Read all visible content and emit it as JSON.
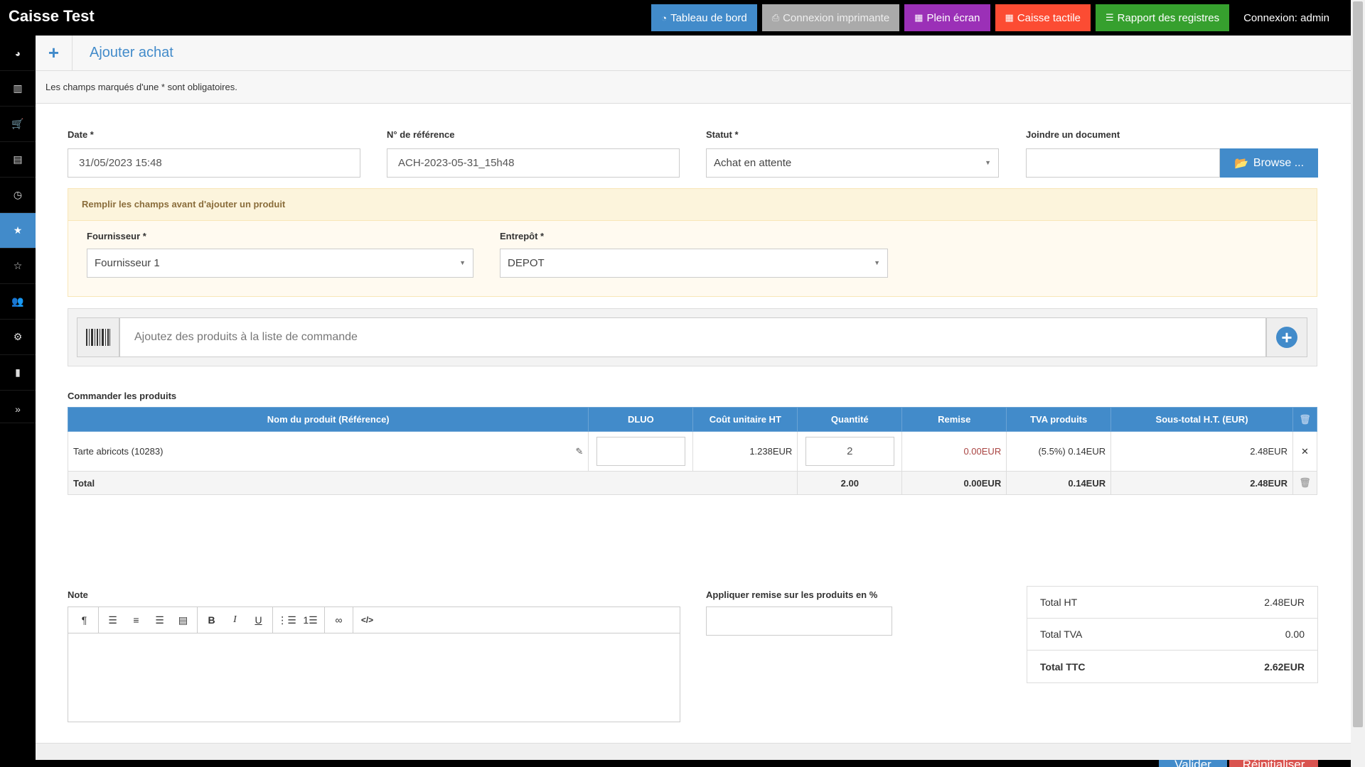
{
  "app": {
    "title": "Caisse Test"
  },
  "topnav": {
    "dashboard": "Tableau de bord",
    "printer": "Connexion imprimante",
    "fullscreen": "Plein écran",
    "touch": "Caisse tactile",
    "register": "Rapport des registres",
    "login": "Connexion: admin"
  },
  "sidebar": {
    "items": [
      "dashboard-icon",
      "barcode-icon",
      "cart-icon",
      "document-icon",
      "clock-icon",
      "star-icon",
      "star-outline-icon",
      "users-icon",
      "gear-icon",
      "chart-icon",
      "expand-icon"
    ],
    "active_index": 5
  },
  "page": {
    "title": "Ajouter achat",
    "required_note": "Les champs marqués d'une * sont obligatoires."
  },
  "form": {
    "date_label": "Date *",
    "date_value": "31/05/2023 15:48",
    "ref_label": "N° de référence",
    "ref_value": "ACH-2023-05-31_15h48",
    "status_label": "Statut *",
    "status_value": "Achat en attente",
    "attach_label": "Joindre un document",
    "browse_label": "Browse ...",
    "notice": "Remplir les champs avant d'ajouter un produit",
    "supplier_label": "Fournisseur *",
    "supplier_value": "Fournisseur 1",
    "warehouse_label": "Entrepôt *",
    "warehouse_value": "DEPOT",
    "add_placeholder": "Ajoutez des produits à la liste de commande"
  },
  "order": {
    "section_label": "Commander les produits",
    "headers": [
      "Nom du produit (Référence)",
      "DLUO",
      "Coût unitaire HT",
      "Quantité",
      "Remise",
      "TVA produits",
      "Sous-total H.T. (EUR)"
    ],
    "rows": [
      {
        "name": "Tarte abricots (10283)",
        "dluo": "",
        "unit_cost": "1.238EUR",
        "qty": "2",
        "discount": "0.00EUR",
        "tax": "(5.5%) 0.14EUR",
        "subtotal": "2.48EUR"
      }
    ],
    "total": {
      "label": "Total",
      "qty": "2.00",
      "discount": "0.00EUR",
      "tax": "0.14EUR",
      "subtotal": "2.48EUR"
    }
  },
  "note": {
    "label": "Note"
  },
  "discount": {
    "label": "Appliquer remise sur les produits en %",
    "value": ""
  },
  "totals": {
    "ht_label": "Total HT",
    "ht_value": "2.48EUR",
    "tva_label": "Total TVA",
    "tva_value": "0.00",
    "ttc_label": "Total TTC",
    "ttc_value": "2.62EUR"
  },
  "actions": {
    "submit": "Valider",
    "reset": "Réinitialiser"
  },
  "colors": {
    "primary": "#428bca",
    "danger": "#d9534f",
    "warning_bg": "#fcf4dc",
    "discount_text": "#a94442"
  }
}
